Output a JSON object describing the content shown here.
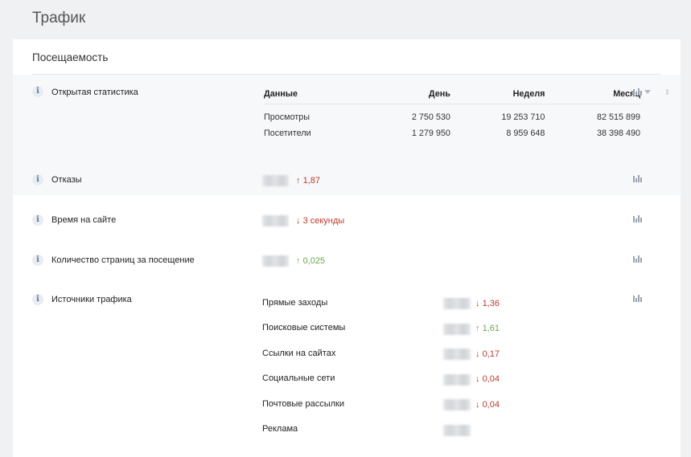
{
  "page": {
    "title": "Трафик"
  },
  "card": {
    "title": "Посещаемость"
  },
  "open_stats": {
    "label": "Открытая статистика",
    "headers": [
      "Данные",
      "День",
      "Неделя",
      "Месяц"
    ],
    "rows": [
      [
        "Просмотры",
        "2 750 530",
        "19 253 710",
        "82 515 899"
      ],
      [
        "Посетители",
        "1 279 950",
        "8 959 648",
        "38 398 490"
      ]
    ]
  },
  "metrics": {
    "bounces": {
      "label": "Отказы",
      "delta": "1,87",
      "direction": "up"
    },
    "time_on_site": {
      "label": "Время на сайте",
      "delta": "3 секунды",
      "direction": "down"
    },
    "pages_per_visit": {
      "label": "Количество страниц за посещение",
      "delta": "0,025",
      "direction": "up"
    }
  },
  "sources": {
    "label": "Источники трафика",
    "items": [
      {
        "name": "Прямые заходы",
        "delta": "1,36",
        "direction": "down"
      },
      {
        "name": "Поисковые системы",
        "delta": "1,61",
        "direction": "up"
      },
      {
        "name": "Ссылки на сайтах",
        "delta": "0,17",
        "direction": "down"
      },
      {
        "name": "Социальные сети",
        "delta": "0,04",
        "direction": "down"
      },
      {
        "name": "Почтовые рассылки",
        "delta": "0,04",
        "direction": "down"
      },
      {
        "name": "Реклама",
        "delta": "",
        "direction": ""
      }
    ]
  },
  "arrows": {
    "up": "↑",
    "down": "↓"
  },
  "icons": {
    "info": "i",
    "chart": "bar-chart-icon",
    "dropdown": "chevron-down-icon"
  },
  "colors": {
    "up": "#6aa84f",
    "down": "#c0392b",
    "bounces_up": "#c0392b"
  }
}
